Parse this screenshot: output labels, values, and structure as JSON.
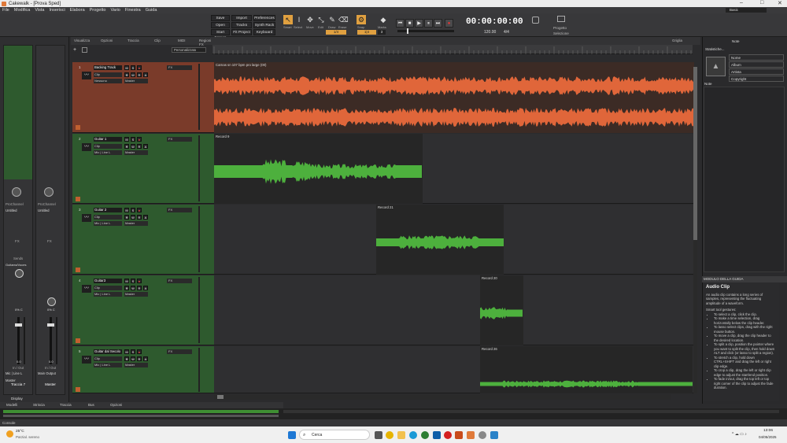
{
  "window": {
    "title": "Cakewalk - [Prova Sped]"
  },
  "menu": [
    "File",
    "Modifica",
    "Vista",
    "Inserisci",
    "Elabora",
    "Progetto",
    "Vario",
    "Finestra",
    "Guida"
  ],
  "transport": {
    "buttons": [
      "Save",
      "Import",
      "Preferences",
      "Open",
      "Tracks",
      "Synth Rack",
      "Start Screen",
      "Fit Project",
      "Keyboard"
    ],
    "tools": [
      "Smart",
      "Select",
      "Move",
      "Edit",
      "Draw",
      "Erase"
    ],
    "snap_label": "Snap",
    "snap_value": "1/4",
    "marks_label": "Marks",
    "position_small": "1|4",
    "position_small_2": "3",
    "clock": "00:00:00:00",
    "tempo": "120.00",
    "signature": "4/4",
    "project_opt": "Progetto",
    "selection_opt": "Selezione"
  },
  "workspace": {
    "label": "Basic"
  },
  "track_header": {
    "items": [
      "Visualizza",
      "Opzioni",
      "Traccia",
      "Clip",
      "MIDI",
      "Regioni FX"
    ],
    "preset": "Personalizzato"
  },
  "clips_header": {
    "label": "Griglia"
  },
  "inspector": {
    "strip1": {
      "name": "Traccia 7",
      "prochannel": "ProChannel",
      "untitled": "Untitled",
      "fx": "FX",
      "sends": "Sends",
      "io": "In / Out",
      "input": "Mic | Line L",
      "output": "Master",
      "fader_val": "0.0",
      "pan": "0% C",
      "gain": "0.0"
    },
    "strip2": {
      "name": "Master",
      "prochannel": "ProChannel",
      "untitled": "Untitled",
      "fx": "FX",
      "io": "In / Out",
      "output": "Main Output",
      "fader_val": "0.0",
      "pan": "0% C",
      "gain": "0.0"
    },
    "tab": "Display",
    "strip_sub": "Guitarra/Voces"
  },
  "tracks": [
    {
      "num": "1",
      "name": "Backing Track",
      "clip": "Clip",
      "input": "Nessuno",
      "output": "Master",
      "fx": "FX"
    },
    {
      "num": "2",
      "name": "Guitar 1",
      "clip": "Clip",
      "input": "Mic | Line L",
      "output": "Master",
      "fx": "FX"
    },
    {
      "num": "3",
      "name": "Guitar 2",
      "clip": "Clip",
      "input": "Mic | Line L",
      "output": "Master",
      "fx": "FX"
    },
    {
      "num": "4",
      "name": "Guitar3",
      "clip": "Clip",
      "input": "Mic | Line L",
      "output": "Master",
      "fx": "FX"
    },
    {
      "num": "5",
      "name": "Guitar dal Secolo",
      "clip": "Clip",
      "input": "Mic | Line L",
      "output": "Master",
      "fx": "FX"
    }
  ],
  "clips": [
    {
      "title": "Carnas sn 107 bpm pro large (00)"
    },
    {
      "title": "Record 9"
    },
    {
      "title": "Record 21"
    },
    {
      "title": "Record 20"
    },
    {
      "title": "Record 26"
    }
  ],
  "browser": {
    "tab": "Statistiche...",
    "note_header": "Note",
    "props": [
      "Nome",
      "Album",
      "Artista",
      "Copyright"
    ],
    "note_label": "Note"
  },
  "help": {
    "header": "MODULO DELLA GUIDA",
    "title": "Audio Clip",
    "intro": "An audio clip contains a long series of samples, representing the fluctuating amplitude of a waveform.",
    "smart": "Smart tool gestures:",
    "items": [
      "To select a clip, click the clip.",
      "To make a time selection, drag horizontally below the clip header.",
      "To lasso select clips, drag with the right mouse button.",
      "To move a clip, drag the clip header to the desired location.",
      "To split a clip, position the pointer where you want to split the clip, then hold down ALT and click (or lasso to split a region).",
      "To stretch a clip, hold down CTRL+SHIFT and drag the left or right clip edge.",
      "To crop a clip, drag the left or right clip edge to adjust the start/end position.",
      "To fade in/out, drag the top left or top right corner of the clip to adjust the fade duration."
    ]
  },
  "bottom_tabs": [
    "Modelli",
    "Striscia",
    "Traccia",
    "Bus",
    "Opzioni"
  ],
  "console": {
    "label": "Console"
  },
  "taskbar": {
    "weather_temp": "25°C",
    "weather_desc": "Parzial. sereno",
    "search": "Cerca",
    "time": "13:06",
    "date": "04/05/2025"
  },
  "colors": {
    "accent": "#e07a3a",
    "track_green": "#2e5a2e",
    "track_orange": "#7a3b2a",
    "wave_green": "#4db03d",
    "wave_orange": "#e0663a"
  }
}
